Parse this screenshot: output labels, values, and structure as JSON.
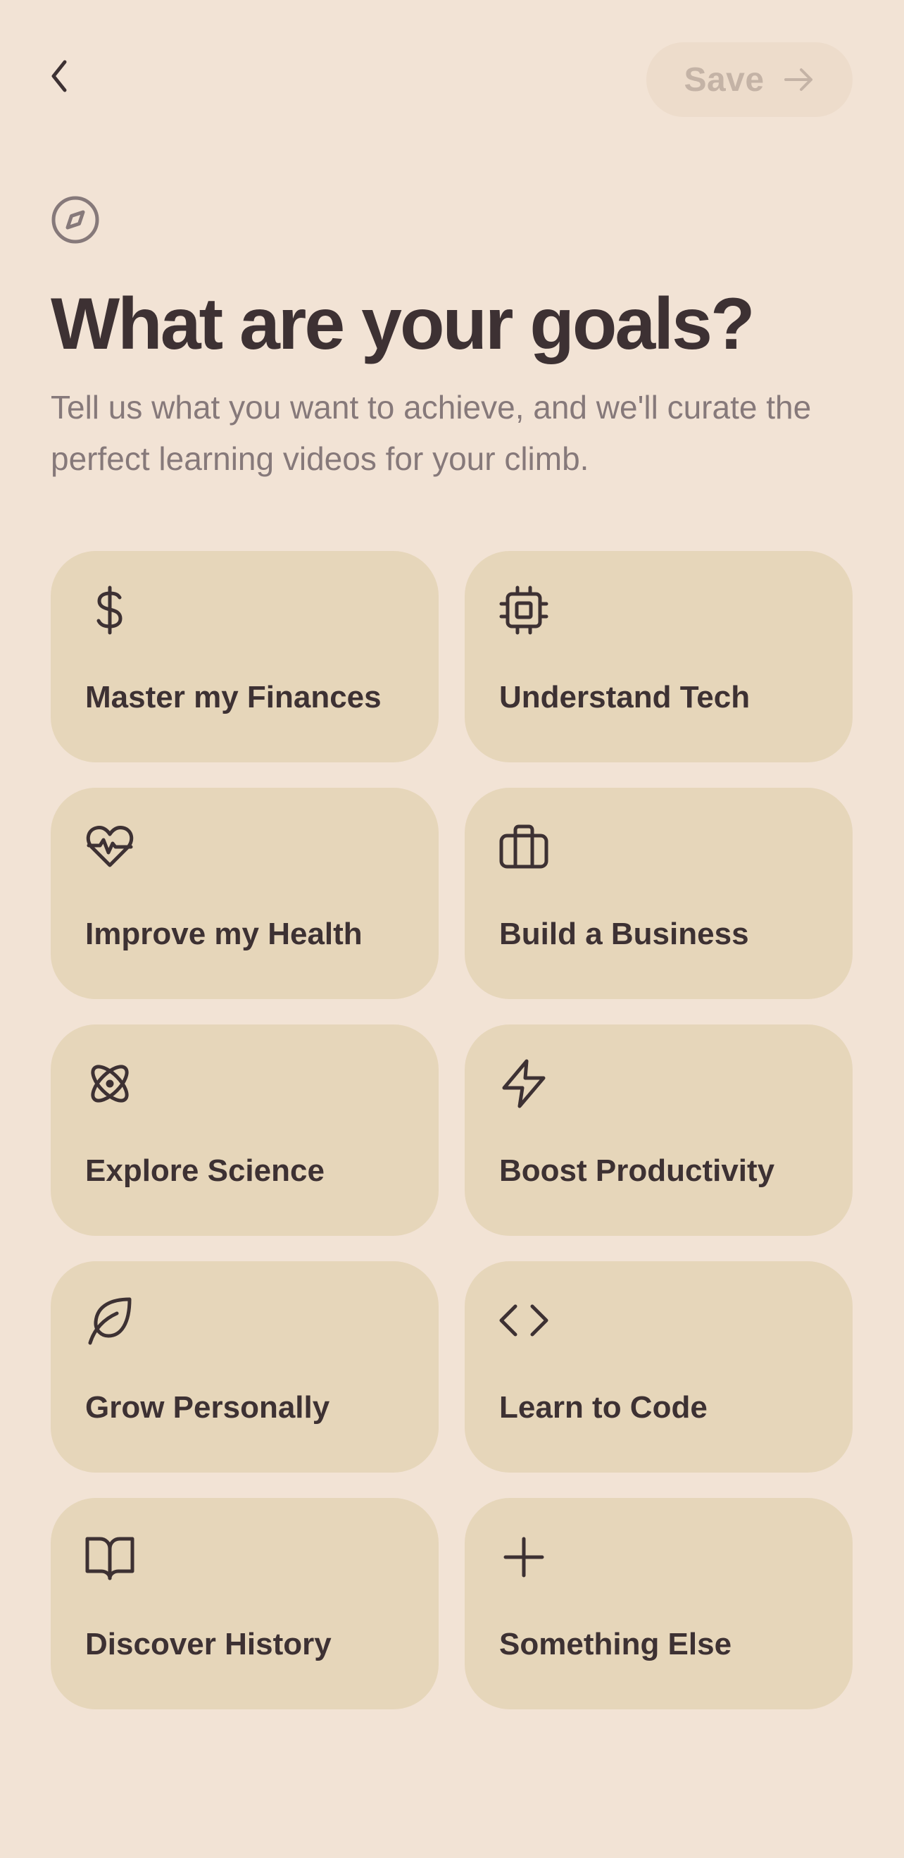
{
  "header": {
    "back_icon": "chevron-left-icon",
    "save_label": "Save",
    "save_icon": "arrow-right-icon"
  },
  "intro": {
    "icon": "compass-icon",
    "title": "What are your goals?",
    "subtitle": "Tell us what you want to achieve, and we'll curate the perfect learning videos for your climb."
  },
  "goals": [
    {
      "label": "Master my Finances",
      "icon": "dollar-sign-icon"
    },
    {
      "label": "Understand Tech",
      "icon": "cpu-chip-icon"
    },
    {
      "label": "Improve my Health",
      "icon": "heart-pulse-icon"
    },
    {
      "label": "Build a Business",
      "icon": "briefcase-icon"
    },
    {
      "label": "Explore Science",
      "icon": "atom-icon"
    },
    {
      "label": "Boost Productivity",
      "icon": "lightning-bolt-icon"
    },
    {
      "label": "Grow Personally",
      "icon": "leaf-icon"
    },
    {
      "label": "Learn to Code",
      "icon": "code-brackets-icon"
    },
    {
      "label": "Discover History",
      "icon": "open-book-icon"
    },
    {
      "label": "Something Else",
      "icon": "plus-icon"
    }
  ],
  "colors": {
    "background": "#f2e3d5",
    "card": "#e6d6ba",
    "text_primary": "#3d3133",
    "text_secondary": "#86797a",
    "save_button_bg": "#eddccb",
    "save_button_text_disabled": "#c4b3a6"
  }
}
